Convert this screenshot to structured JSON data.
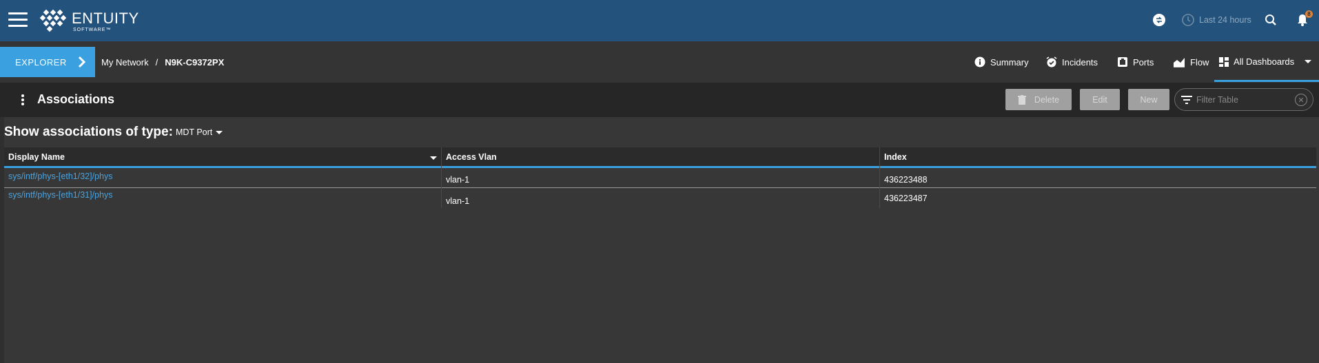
{
  "app": {
    "brand_name": "ENTUITY",
    "brand_sub": "SOFTWARE™"
  },
  "topbar": {
    "time_range": "Last 24 hours",
    "notification_count": "8",
    "icons": [
      "menu-icon",
      "sync-icon",
      "clock-icon",
      "search-icon",
      "bell-icon"
    ]
  },
  "nav": {
    "explorer_label": "EXPLORER",
    "breadcrumb": [
      "My Network",
      "N9K-C9372PX"
    ],
    "breadcrumb_sep": "/",
    "tabs": [
      {
        "label": "Summary",
        "icon": "info-icon"
      },
      {
        "label": "Incidents",
        "icon": "alarm-icon"
      },
      {
        "label": "Ports",
        "icon": "port-icon"
      },
      {
        "label": "Flow",
        "icon": "flow-icon"
      },
      {
        "label": "All Dashboards",
        "icon": "dashboard-icon"
      }
    ]
  },
  "panel": {
    "title": "Associations",
    "buttons": {
      "delete": "Delete",
      "edit": "Edit",
      "new": "New"
    },
    "filter_placeholder": "Filter Table"
  },
  "assoc": {
    "label": "Show associations of type:",
    "type_value": "MDT Port"
  },
  "table": {
    "columns": [
      "Display Name",
      "Access Vlan",
      "Index"
    ],
    "rows": [
      {
        "name": "sys/intf/phys-[eth1/32]/phys",
        "vlan": "vlan-1",
        "index": "436223488"
      },
      {
        "name": "sys/intf/phys-[eth1/31]/phys",
        "vlan": "vlan-1",
        "index": "436223487"
      }
    ]
  },
  "colors": {
    "topbar": "#23537d",
    "accent": "#3aa0e0",
    "link": "#4aa3df",
    "badge": "#d9823b"
  }
}
